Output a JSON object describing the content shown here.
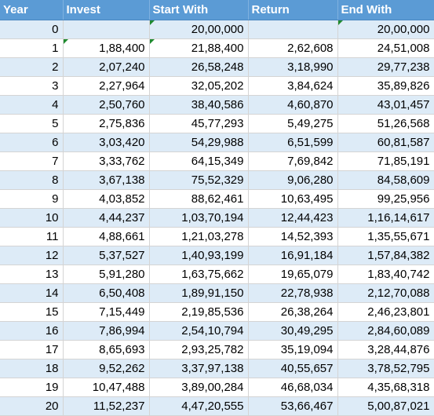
{
  "headers": {
    "year": "Year",
    "invest": "Invest",
    "start": "Start With",
    "return": "Return",
    "end": "End With"
  },
  "colors": {
    "header_bg": "#5b9bd5",
    "band": "#ddebf7",
    "error_marker": "#1e8a2e"
  },
  "rows": [
    {
      "year": "0",
      "invest": "",
      "start": "20,00,000",
      "return": "",
      "end": "20,00,000"
    },
    {
      "year": "1",
      "invest": "1,88,400",
      "start": "21,88,400",
      "return": "2,62,608",
      "end": "24,51,008"
    },
    {
      "year": "2",
      "invest": "2,07,240",
      "start": "26,58,248",
      "return": "3,18,990",
      "end": "29,77,238"
    },
    {
      "year": "3",
      "invest": "2,27,964",
      "start": "32,05,202",
      "return": "3,84,624",
      "end": "35,89,826"
    },
    {
      "year": "4",
      "invest": "2,50,760",
      "start": "38,40,586",
      "return": "4,60,870",
      "end": "43,01,457"
    },
    {
      "year": "5",
      "invest": "2,75,836",
      "start": "45,77,293",
      "return": "5,49,275",
      "end": "51,26,568"
    },
    {
      "year": "6",
      "invest": "3,03,420",
      "start": "54,29,988",
      "return": "6,51,599",
      "end": "60,81,587"
    },
    {
      "year": "7",
      "invest": "3,33,762",
      "start": "64,15,349",
      "return": "7,69,842",
      "end": "71,85,191"
    },
    {
      "year": "8",
      "invest": "3,67,138",
      "start": "75,52,329",
      "return": "9,06,280",
      "end": "84,58,609"
    },
    {
      "year": "9",
      "invest": "4,03,852",
      "start": "88,62,461",
      "return": "10,63,495",
      "end": "99,25,956"
    },
    {
      "year": "10",
      "invest": "4,44,237",
      "start": "1,03,70,194",
      "return": "12,44,423",
      "end": "1,16,14,617"
    },
    {
      "year": "11",
      "invest": "4,88,661",
      "start": "1,21,03,278",
      "return": "14,52,393",
      "end": "1,35,55,671"
    },
    {
      "year": "12",
      "invest": "5,37,527",
      "start": "1,40,93,199",
      "return": "16,91,184",
      "end": "1,57,84,382"
    },
    {
      "year": "13",
      "invest": "5,91,280",
      "start": "1,63,75,662",
      "return": "19,65,079",
      "end": "1,83,40,742"
    },
    {
      "year": "14",
      "invest": "6,50,408",
      "start": "1,89,91,150",
      "return": "22,78,938",
      "end": "2,12,70,088"
    },
    {
      "year": "15",
      "invest": "7,15,449",
      "start": "2,19,85,536",
      "return": "26,38,264",
      "end": "2,46,23,801"
    },
    {
      "year": "16",
      "invest": "7,86,994",
      "start": "2,54,10,794",
      "return": "30,49,295",
      "end": "2,84,60,089"
    },
    {
      "year": "17",
      "invest": "8,65,693",
      "start": "2,93,25,782",
      "return": "35,19,094",
      "end": "3,28,44,876"
    },
    {
      "year": "18",
      "invest": "9,52,262",
      "start": "3,37,97,138",
      "return": "40,55,657",
      "end": "3,78,52,795"
    },
    {
      "year": "19",
      "invest": "10,47,488",
      "start": "3,89,00,284",
      "return": "46,68,034",
      "end": "4,35,68,318"
    },
    {
      "year": "20",
      "invest": "11,52,237",
      "start": "4,47,20,555",
      "return": "53,66,467",
      "end": "5,00,87,021"
    }
  ]
}
